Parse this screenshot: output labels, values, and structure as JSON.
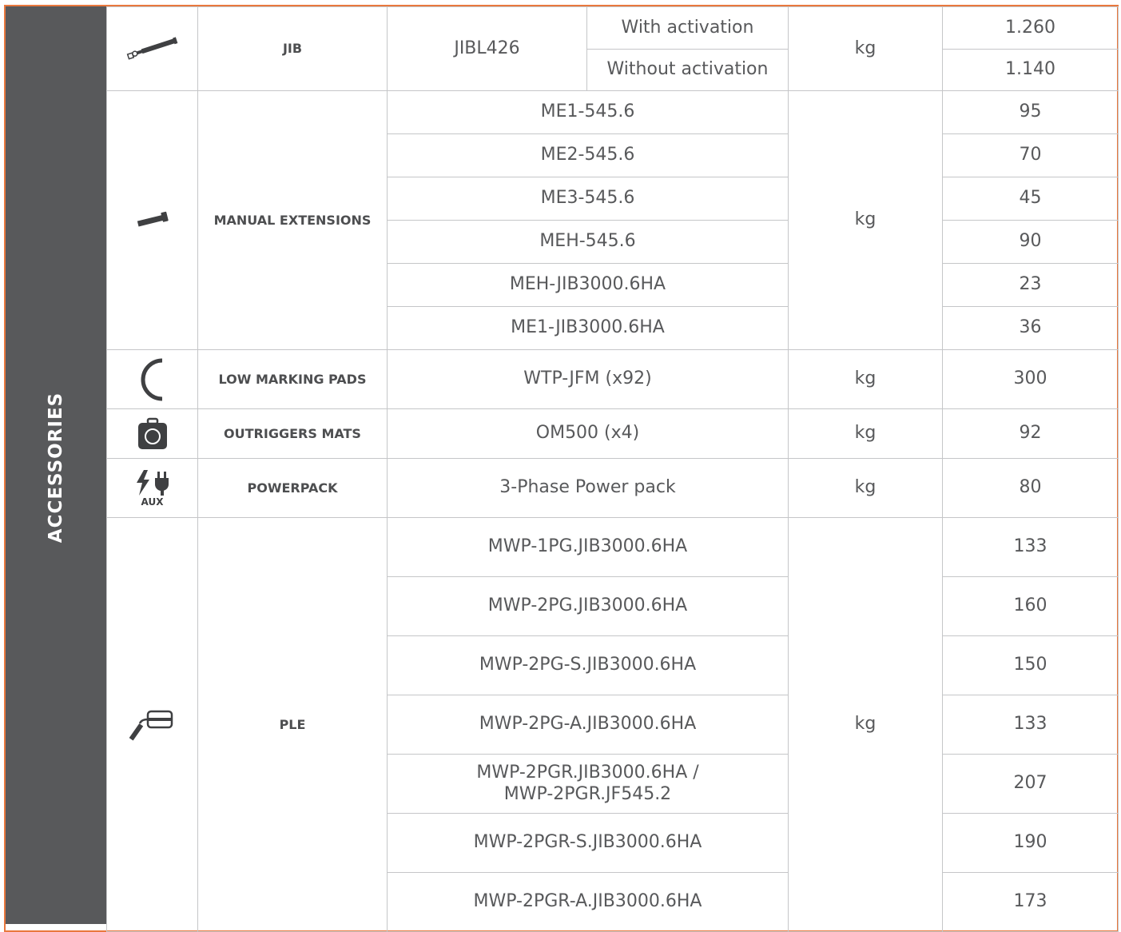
{
  "section_label": "ACCESSORIES",
  "colors": {
    "accent_border": "#e9783e",
    "sidebar_bg": "#58595b",
    "text": "#58595b",
    "grid": "#c5c6c8"
  },
  "rows": {
    "jib": {
      "icon": "jib-arm-icon",
      "category": "JIB",
      "model": "JIBL426",
      "variants": [
        {
          "label": "With activation",
          "value": "1.260"
        },
        {
          "label": "Without activation",
          "value": "1.140"
        }
      ],
      "unit": "kg"
    },
    "manual_extensions": {
      "icon": "extension-bar-icon",
      "category": "MANUAL EXTENSIONS",
      "unit": "kg",
      "items": [
        {
          "model": "ME1-545.6",
          "value": "95"
        },
        {
          "model": "ME2-545.6",
          "value": "70"
        },
        {
          "model": "ME3-545.6",
          "value": "45"
        },
        {
          "model": "MEH-545.6",
          "value": "90"
        },
        {
          "model": "MEH-JIB3000.6HA",
          "value": "23"
        },
        {
          "model": "ME1-JIB3000.6HA",
          "value": "36"
        }
      ]
    },
    "low_marking_pads": {
      "icon": "track-pad-icon",
      "category": "LOW MARKING PADS",
      "model": "WTP-JFM (x92)",
      "unit": "kg",
      "value": "300"
    },
    "outriggers_mats": {
      "icon": "mat-bag-icon",
      "category": "OUTRIGGERS MATS",
      "model": "OM500 (x4)",
      "unit": "kg",
      "value": "92"
    },
    "powerpack": {
      "icon": "bolt-plug-icon",
      "icon_caption": "AUX",
      "category": "POWERPACK",
      "model": "3-Phase Power pack",
      "unit": "kg",
      "value": "80"
    },
    "ple": {
      "icon": "platform-basket-icon",
      "category": "PLE",
      "unit": "kg",
      "items": [
        {
          "model": "MWP-1PG.JIB3000.6HA",
          "value": "133"
        },
        {
          "model": "MWP-2PG.JIB3000.6HA",
          "value": "160"
        },
        {
          "model": "MWP-2PG-S.JIB3000.6HA",
          "value": "150"
        },
        {
          "model": "MWP-2PG-A.JIB3000.6HA",
          "value": "133"
        },
        {
          "model": "MWP-2PGR.JIB3000.6HA /\nMWP-2PGR.JF545.2",
          "value": "207"
        },
        {
          "model": "MWP-2PGR-S.JIB3000.6HA",
          "value": "190"
        },
        {
          "model": "MWP-2PGR-A.JIB3000.6HA",
          "value": "173"
        }
      ]
    }
  }
}
